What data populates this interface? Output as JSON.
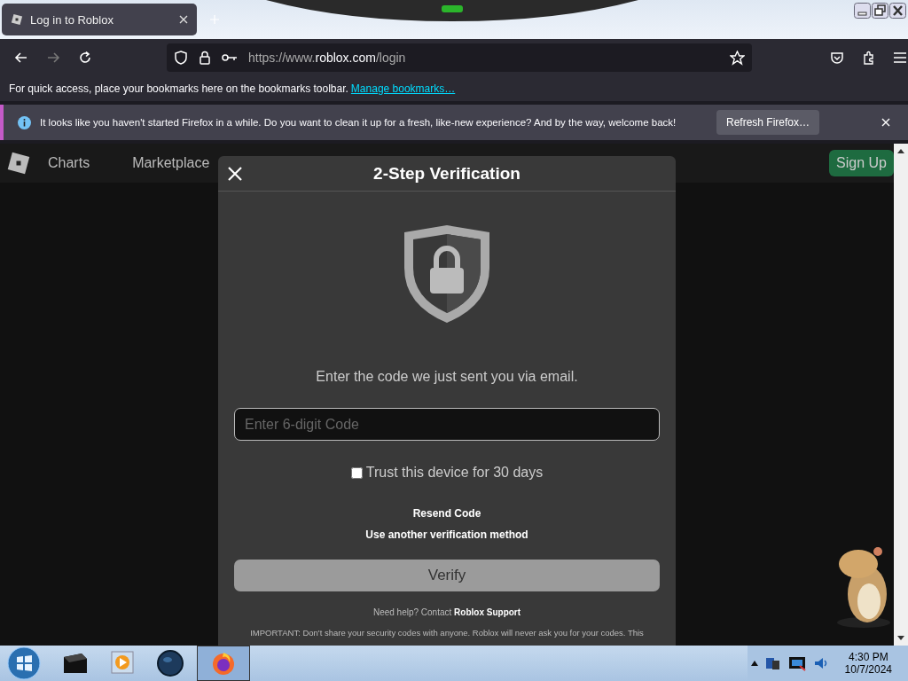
{
  "tab": {
    "title": "Log in to Roblox",
    "selected": true
  },
  "address": {
    "prefix": "https://www.",
    "domain": "roblox.com",
    "path": "/login"
  },
  "bookmarks_bar": {
    "text": "For quick access, place your bookmarks here on the bookmarks toolbar.",
    "link": "Manage bookmarks…"
  },
  "notification": {
    "message": "It looks like you haven't started Firefox in a while. Do you want to clean it up for a fresh, like-new experience? And by the way, welcome back!",
    "button": "Refresh Firefox…"
  },
  "site_nav": {
    "items": [
      "Charts",
      "Marketplace"
    ],
    "sign_up": "Sign Up"
  },
  "modal": {
    "title": "2-Step Verification",
    "message": "Enter the code we just sent you via email.",
    "code_field": {
      "placeholder": "Enter 6-digit Code"
    },
    "trust_device": {
      "label": "Trust this device for 30 days",
      "checked": false
    },
    "links": [
      "Resend Code",
      "Use another verification method"
    ],
    "verify_button": {
      "label": "Verify",
      "disabled": true
    },
    "help": "Need help? Contact **Roblox Support**",
    "important": "IMPORTANT: Don't share your security codes with anyone. Roblox will never ask you for your codes. This"
  },
  "taskbar": {
    "time": "4:30 PM",
    "date": "10/7/2024"
  }
}
